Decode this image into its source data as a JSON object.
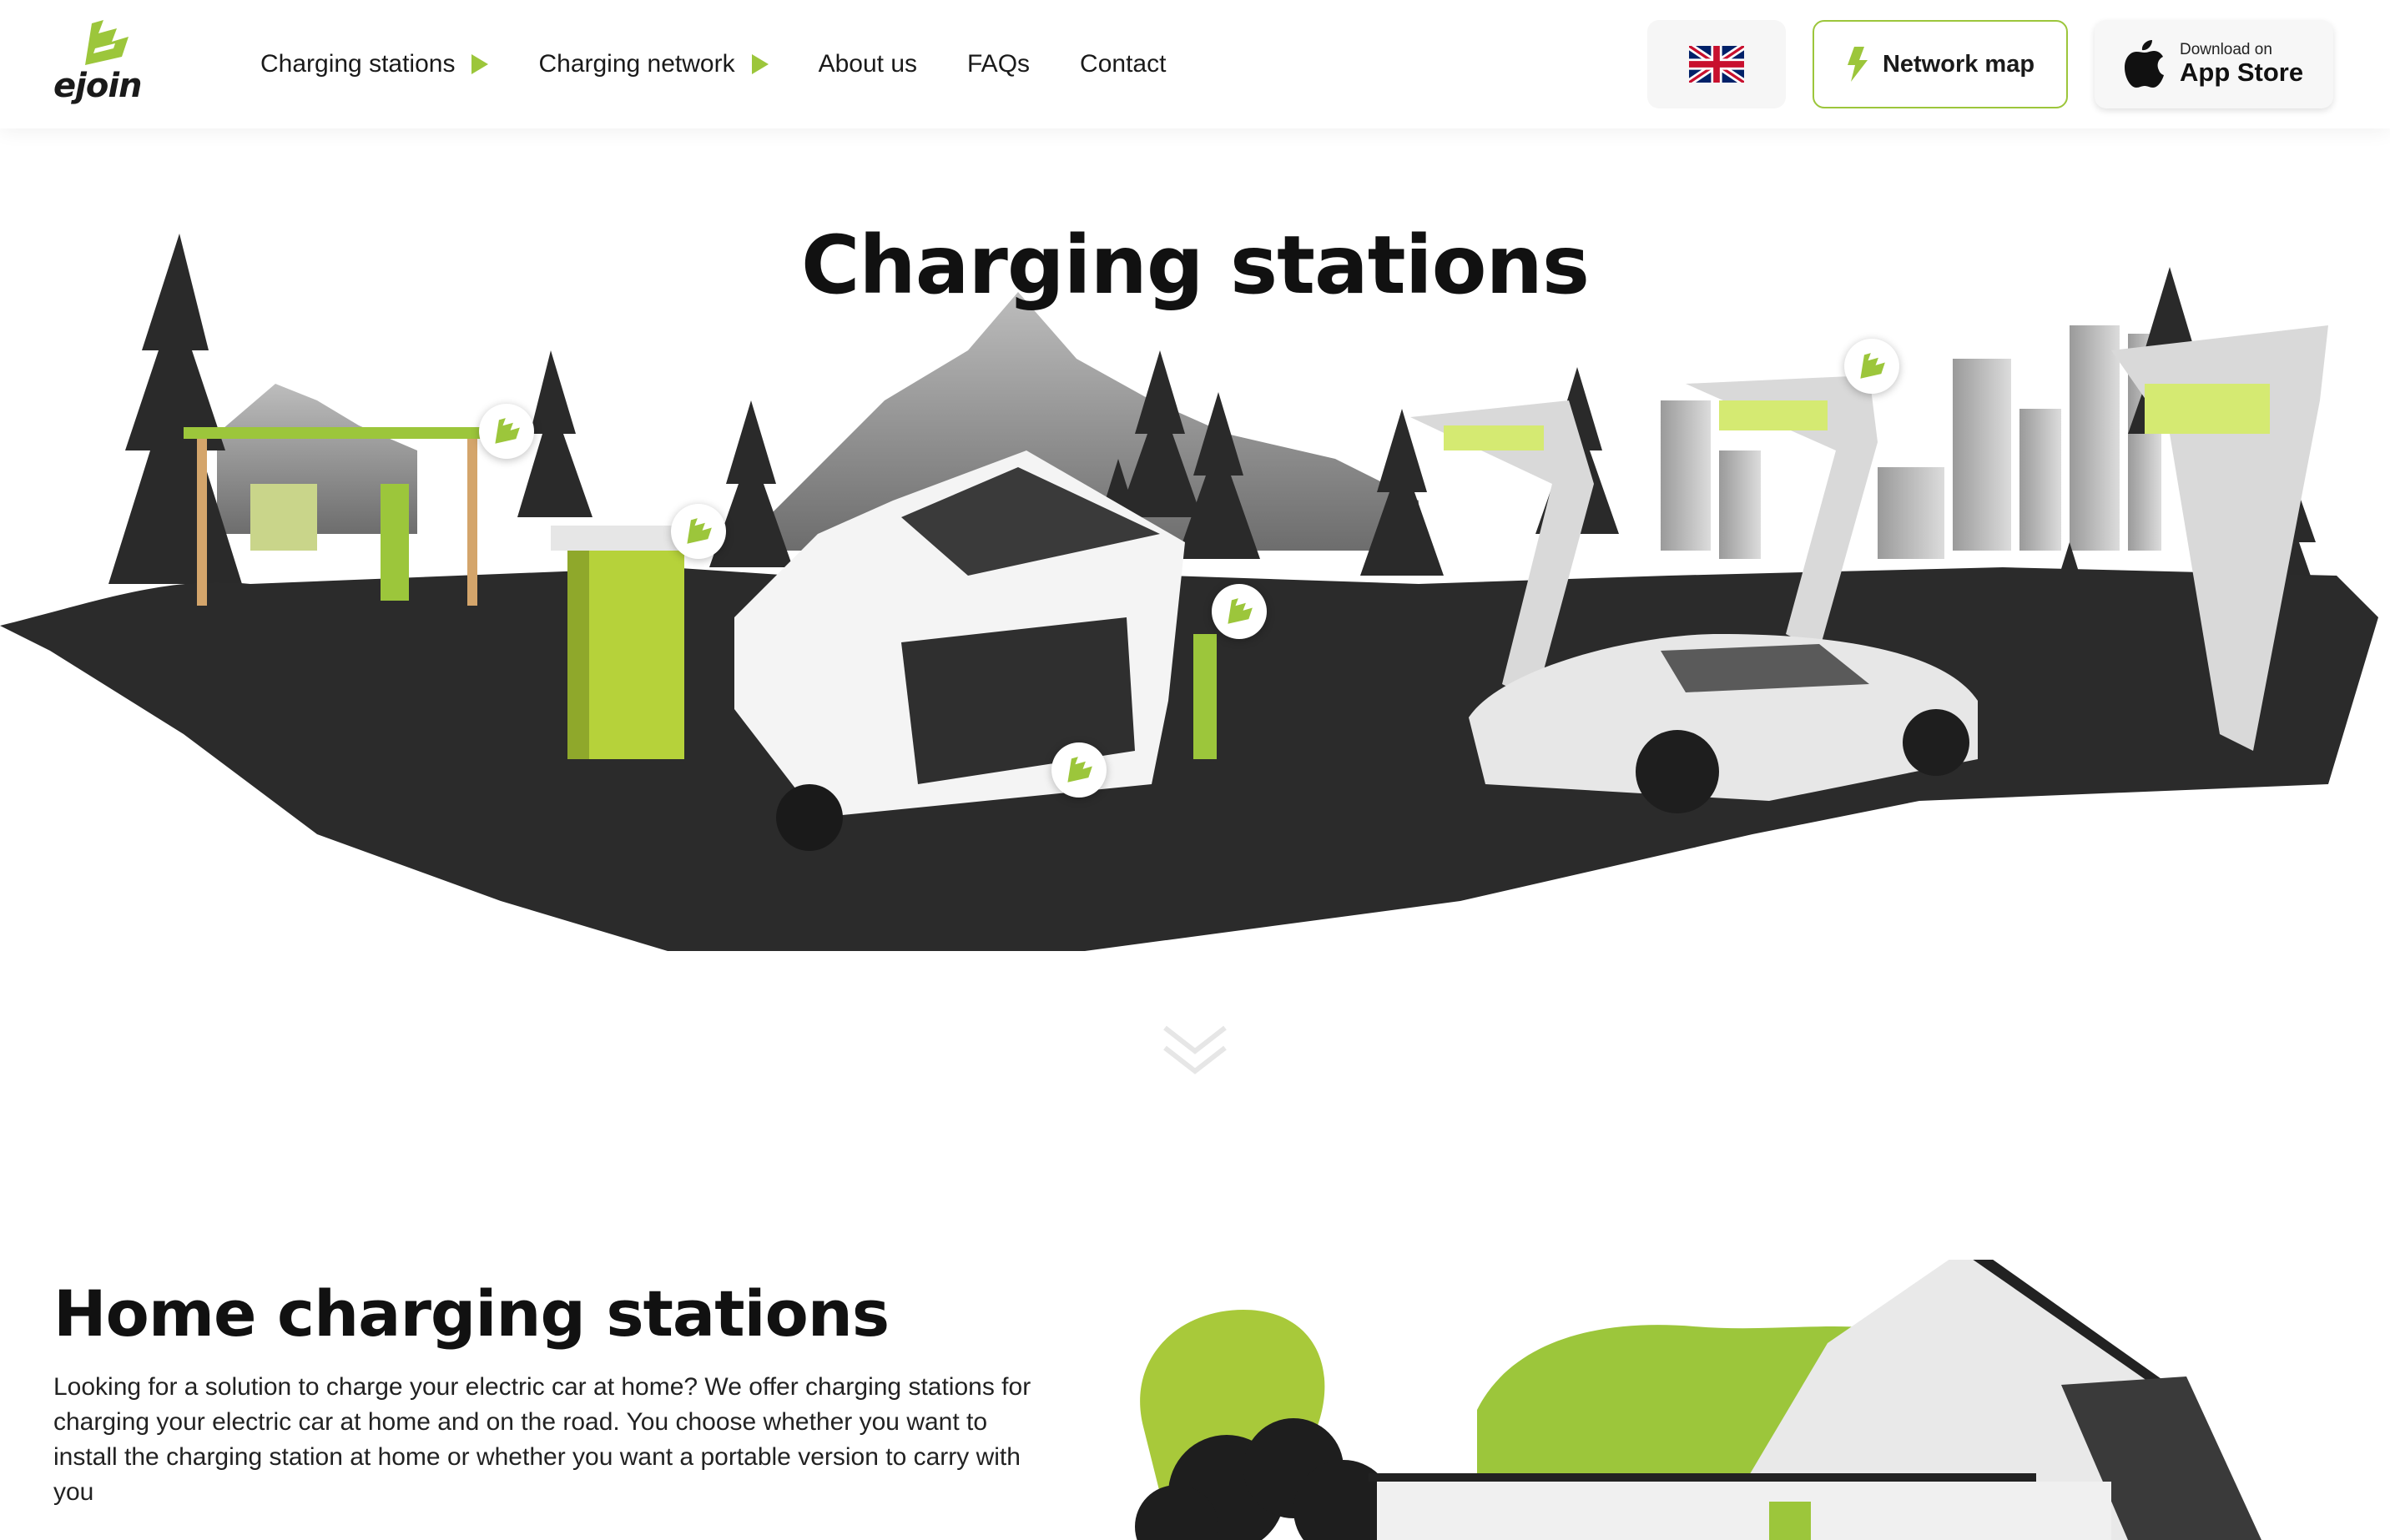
{
  "header": {
    "logo_text": "ejoin",
    "nav": [
      {
        "label": "Charging stations",
        "has_arrow": true
      },
      {
        "label": "Charging network",
        "has_arrow": true
      },
      {
        "label": "About us",
        "has_arrow": false
      },
      {
        "label": "FAQs",
        "has_arrow": false
      },
      {
        "label": "Contact",
        "has_arrow": false
      }
    ],
    "language_icon": "uk-flag-icon",
    "network_map_label": "Network map",
    "network_map_icon": "lightning-icon",
    "app_store": {
      "small": "Download on",
      "big": "App Store",
      "icon": "apple-icon"
    }
  },
  "hero": {
    "title": "Charging stations",
    "scroll_icon": "chevron-down-icon"
  },
  "home": {
    "title": "Home charging stations",
    "text": "Looking for a solution to charge your electric car at home? We offer charging stations for charging your electric car at home and on the road. You choose whether you want to install the charging station at home or whether you want a portable version to carry with you"
  },
  "colors": {
    "accent": "#9cc63b",
    "ground": "#2b2b2b",
    "text": "#111111"
  }
}
